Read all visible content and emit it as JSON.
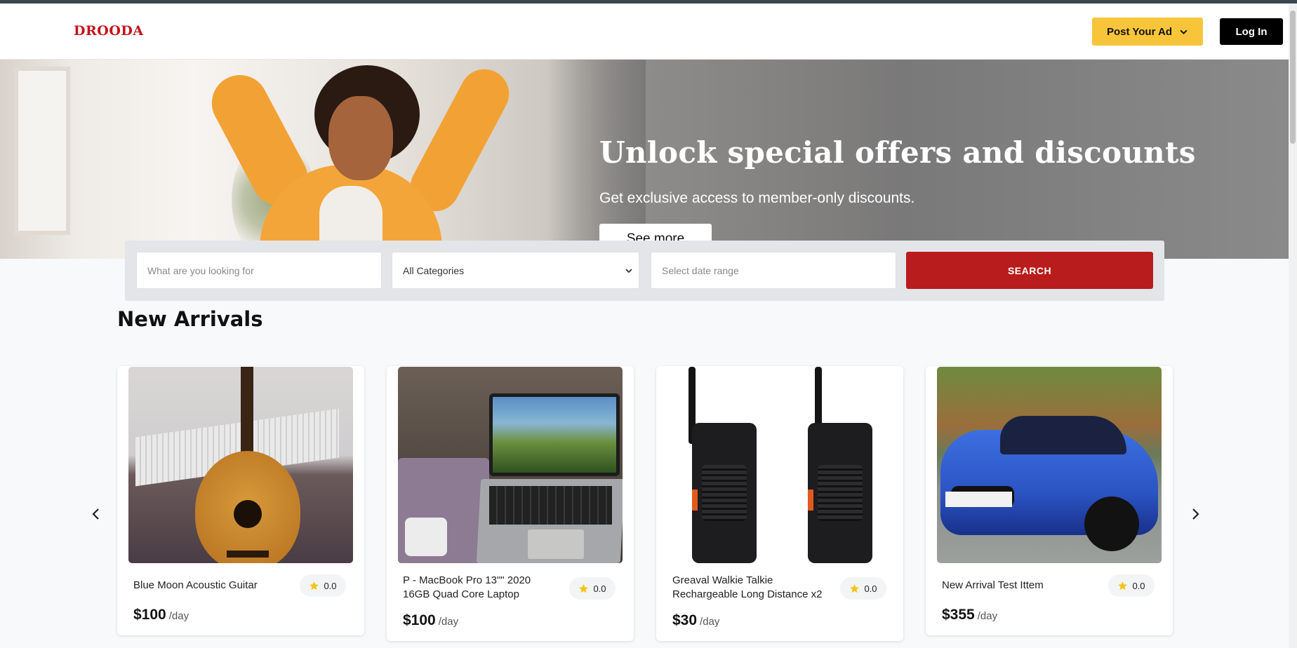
{
  "header": {
    "logo": "DROODA",
    "post_ad_label": "Post Your Ad",
    "login_label": "Log In"
  },
  "hero": {
    "title": "Unlock special offers and discounts",
    "subtitle": "Get exclusive access to member-only discounts.",
    "cta_label": "See more"
  },
  "search": {
    "query_placeholder": "What are you looking for",
    "category_selected": "All Categories",
    "date_placeholder": "Select date range",
    "button_label": "SEARCH"
  },
  "new_arrivals": {
    "title": "New Arrivals",
    "items": [
      {
        "name": "Blue Moon Acoustic Guitar",
        "rating": "0.0",
        "price": "$100",
        "unit": "/day"
      },
      {
        "name": "P - MacBook Pro 13\"\" 2020 16GB Quad Core Laptop",
        "rating": "0.0",
        "price": "$100",
        "unit": "/day"
      },
      {
        "name": "Greaval Walkie Talkie Rechargeable Long Distance x2",
        "rating": "0.0",
        "price": "$30",
        "unit": "/day"
      },
      {
        "name": "New Arrival Test Ittem",
        "rating": "0.0",
        "price": "$355",
        "unit": "/day"
      }
    ]
  },
  "colors": {
    "brand_red": "#c4121c",
    "search_red": "#b91c1c",
    "accent_yellow": "#f8c53a",
    "star": "#f5c518"
  },
  "icons": {
    "post_ad_dropdown": "chevron-down-icon",
    "category_dropdown": "chevron-down-icon",
    "carousel_prev": "chevron-left-icon",
    "carousel_next": "chevron-right-icon",
    "rating": "star-icon"
  }
}
